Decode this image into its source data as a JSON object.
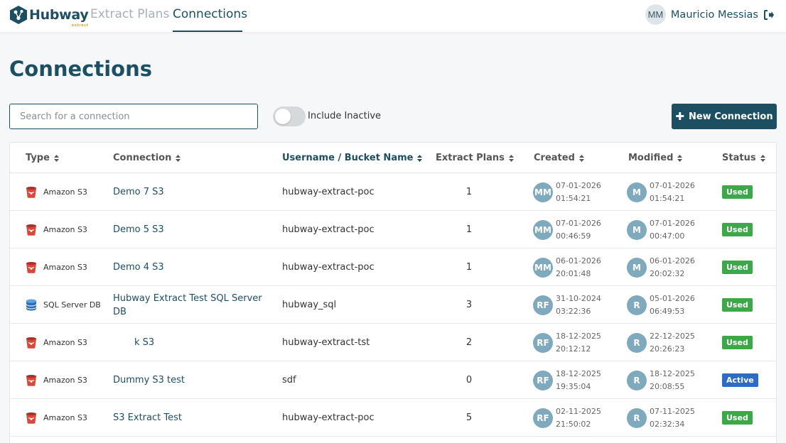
{
  "header": {
    "logo_text": "Hubway",
    "logo_sub": "extract",
    "nav": [
      {
        "label": "Extract Plans"
      },
      {
        "label": "Connections"
      }
    ],
    "user": {
      "initials": "MM",
      "name": "Mauricio Messias"
    }
  },
  "page": {
    "title": "Connections",
    "search_placeholder": "Search for a connection",
    "toggle_label": "Include Inactive",
    "toggle_on": false,
    "new_button_label": "New Connection"
  },
  "table": {
    "columns": [
      "Type",
      "Connection",
      "Username / Bucket Name",
      "Extract Plans",
      "Created",
      "Modified",
      "Status"
    ],
    "rows": [
      {
        "type": "Amazon S3",
        "icon": "amazon-s3-icon",
        "name": "Demo 7 S3",
        "user": "hubway-extract-poc",
        "plans": "1",
        "created_by": "MM",
        "created_date": "07-01-2026",
        "created_time": "01:54:21",
        "modified_by": "M",
        "modified_date": "07-01-2026",
        "modified_time": "01:54:21",
        "status": "Used"
      },
      {
        "type": "Amazon S3",
        "icon": "amazon-s3-icon",
        "name": "Demo 5 S3",
        "user": "hubway-extract-poc",
        "plans": "1",
        "created_by": "MM",
        "created_date": "07-01-2026",
        "created_time": "00:46:59",
        "modified_by": "M",
        "modified_date": "07-01-2026",
        "modified_time": "00:47:00",
        "status": "Used"
      },
      {
        "type": "Amazon S3",
        "icon": "amazon-s3-icon",
        "name": "Demo 4 S3",
        "user": "hubway-extract-poc",
        "plans": "1",
        "created_by": "MM",
        "created_date": "06-01-2026",
        "created_time": "20:01:48",
        "modified_by": "M",
        "modified_date": "06-01-2026",
        "modified_time": "20:02:32",
        "status": "Used"
      },
      {
        "type": "SQL Server DB",
        "icon": "sql-server-icon",
        "name": "Hubway Extract Test SQL Server DB",
        "user": "hubway_sql",
        "plans": "3",
        "created_by": "RF",
        "created_date": "31-10-2024",
        "created_time": "03:22:36",
        "modified_by": "R",
        "modified_date": "05-01-2026",
        "modified_time": "06:49:53",
        "status": "Used"
      },
      {
        "type": "Amazon S3",
        "icon": "amazon-s3-icon",
        "name": "k S3",
        "user": "hubway-extract-tst",
        "plans": "2",
        "created_by": "RF",
        "created_date": "18-12-2025",
        "created_time": "20:12:12",
        "modified_by": "R",
        "modified_date": "22-12-2025",
        "modified_time": "20:26:23",
        "status": "Used"
      },
      {
        "type": "Amazon S3",
        "icon": "amazon-s3-icon",
        "name": "Dummy S3 test",
        "user": "sdf",
        "plans": "0",
        "created_by": "RF",
        "created_date": "18-12-2025",
        "created_time": "19:35:04",
        "modified_by": "R",
        "modified_date": "18-12-2025",
        "modified_time": "20:08:55",
        "status": "Active"
      },
      {
        "type": "Amazon S3",
        "icon": "amazon-s3-icon",
        "name": "S3 Extract Test",
        "user": "hubway-extract-poc",
        "plans": "5",
        "created_by": "RF",
        "created_date": "02-11-2025",
        "created_time": "21:50:02",
        "modified_by": "R",
        "modified_date": "07-11-2025",
        "modified_time": "02:32:34",
        "status": "Used"
      }
    ]
  },
  "colors": {
    "brand": "#1d4f63",
    "used": "#3da84a",
    "active": "#2e6bc4",
    "avatar": "#7fa9bd"
  }
}
